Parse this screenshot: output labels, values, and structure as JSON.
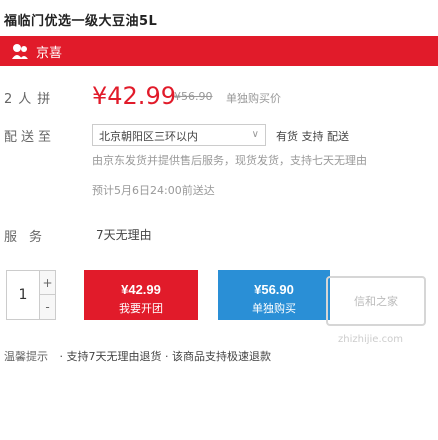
{
  "page": {
    "title": "福临门优选一级大豆油5L"
  },
  "banner": {
    "shop_name": "京喜",
    "bg_color": "#e11b2a"
  },
  "price": {
    "label": "2人拼",
    "value": "¥42.99",
    "original": "¥56.90",
    "note": "单独购买价"
  },
  "shipping": {
    "label": "配送至",
    "address": "北京朝阳区三环以内",
    "status": "有货  支持  配送",
    "info": "由京东发货并提供售后服务，现货发货，支持七天无理由",
    "date": "预计5月6日24:00前送达"
  },
  "service": {
    "label": "服务",
    "value": "7天无理由"
  },
  "quantity": {
    "value": "1",
    "plus": "+",
    "minus": "-"
  },
  "buttons": {
    "buy": {
      "price": "¥42.99",
      "text": "我要开团"
    },
    "cart": {
      "price": "¥56.90",
      "text": "单独购买"
    }
  },
  "watermark": {
    "text": "信和之家",
    "sub": "zhizhijie.com"
  },
  "tips": {
    "label": "温馨提示",
    "text": "· 支持7天无理由退货 · 该商品支持极速退款"
  }
}
